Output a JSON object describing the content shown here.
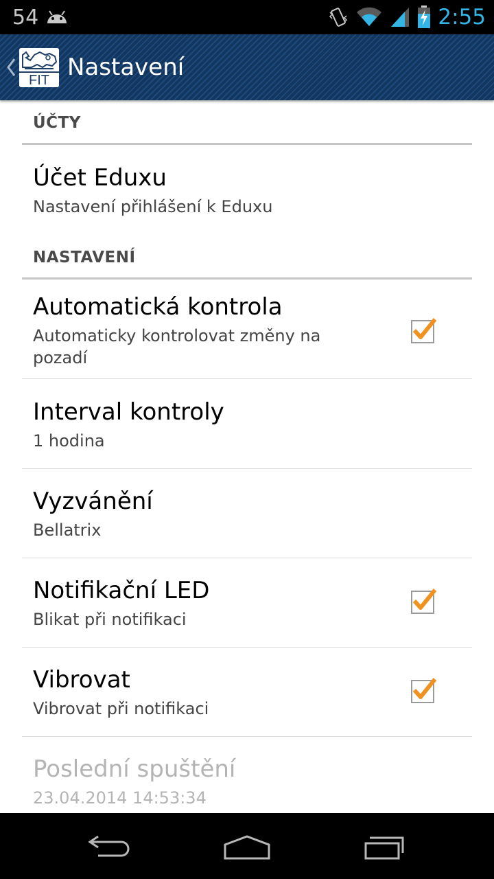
{
  "status_bar": {
    "notification_count": "54",
    "time": "2:55",
    "icons": [
      "android-icon",
      "vibrate-icon",
      "wifi-icon",
      "signal-icon",
      "battery-charging-icon"
    ]
  },
  "action_bar": {
    "logo_text": "FIT",
    "title": "Nastavení"
  },
  "sections": [
    {
      "header": "ÚČTY"
    },
    {
      "header": "NASTAVENÍ"
    }
  ],
  "preferences": {
    "account": {
      "title": "Účet Eduxu",
      "summary": "Nastavení přihlášení k Eduxu"
    },
    "auto_check": {
      "title": "Automatická kontrola",
      "summary": "Automaticky kontrolovat změny na pozadí",
      "checked": true
    },
    "interval": {
      "title": "Interval kontroly",
      "summary": "1 hodina"
    },
    "ringtone": {
      "title": "Vyzvánění",
      "summary": "Bellatrix"
    },
    "led": {
      "title": "Notifikační LED",
      "summary": "Blikat při notifikaci",
      "checked": true
    },
    "vibrate": {
      "title": "Vibrovat",
      "summary": "Vibrovat při notifikaci",
      "checked": true
    },
    "last_run": {
      "title": "Poslední spuštění",
      "summary": "23.04.2014 14:53:34",
      "enabled": false
    }
  },
  "nav_bar": {
    "icons": [
      "back-icon",
      "home-icon",
      "recent-apps-icon"
    ]
  },
  "colors": {
    "accent": "#33b5e5",
    "check": "#f0921f",
    "action_bar": "#13365e"
  }
}
